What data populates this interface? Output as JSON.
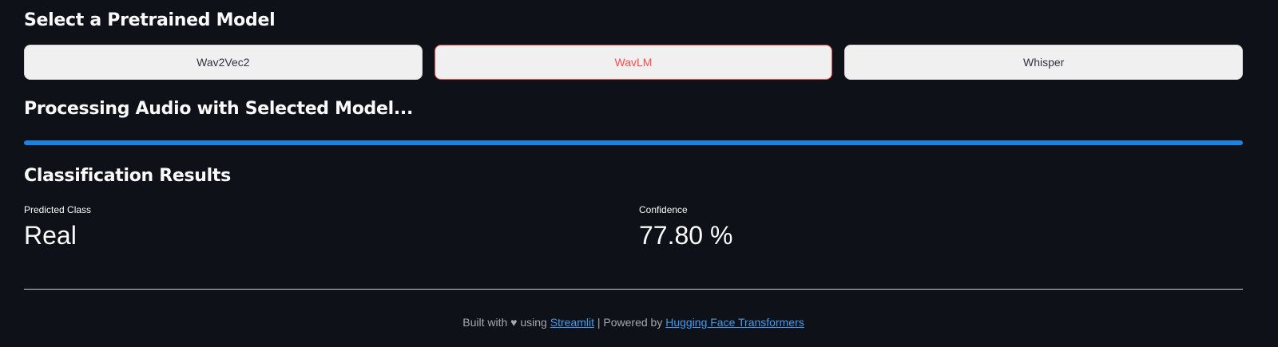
{
  "section_select": {
    "title": "Select a Pretrained Model",
    "models": [
      {
        "label": "Wav2Vec2",
        "selected": false
      },
      {
        "label": "WavLM",
        "selected": true
      },
      {
        "label": "Whisper",
        "selected": false
      }
    ]
  },
  "section_processing": {
    "title": "Processing Audio with Selected Model...",
    "progress_percent": 100
  },
  "section_results": {
    "title": "Classification Results",
    "predicted_class_label": "Predicted Class",
    "predicted_class_value": "Real",
    "confidence_label": "Confidence",
    "confidence_value": "77.80 %"
  },
  "footer": {
    "built_with": "Built with",
    "heart_icon": "heart-icon",
    "using": "using",
    "streamlit_link": "Streamlit",
    "separator": "| Powered by",
    "hf_link": "Hugging Face Transformers"
  },
  "colors": {
    "background": "#0e1117",
    "accent_red": "#ff4b4b",
    "progress_blue": "#1c83e1",
    "link_blue": "#3d9df3"
  }
}
